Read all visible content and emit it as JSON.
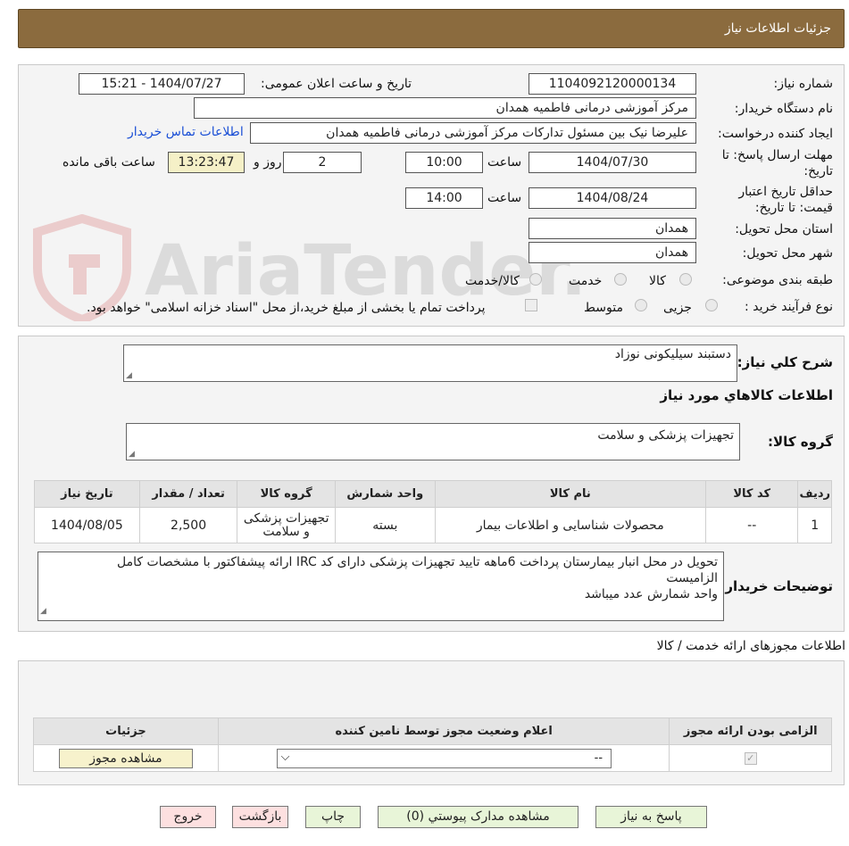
{
  "header": {
    "title": "جزئیات اطلاعات نیاز"
  },
  "watermark": {
    "text": "AriaTender.neT"
  },
  "form": {
    "need_number_label": "شماره نیاز:",
    "need_number": "1104092120000134",
    "announce_label": "تاریخ و ساعت اعلان عمومی:",
    "announce_value": "1404/07/27 - 15:21",
    "buyer_label": "نام دستگاه خریدار:",
    "buyer_value": "مرکز آموزشی درمانی فاطمیه همدان",
    "creator_label": "ایجاد کننده درخواست:",
    "creator_value": "علیرضا نیک بین مسئول تدارکات مرکز آموزشی درمانی فاطمیه همدان",
    "contact_link": "اطلاعات تماس خریدار",
    "deadline_label": "مهلت ارسال پاسخ: تا تاریخ:",
    "deadline_date": "1404/07/30",
    "time_label": "ساعت",
    "deadline_time": "10:00",
    "days_value": "2",
    "days_label": "روز و",
    "remaining_time": "13:23:47",
    "remaining_label": "ساعت باقی مانده",
    "validity_label": "حداقل تاریخ اعتبار قیمت: تا تاریخ:",
    "validity_date": "1404/08/24",
    "validity_time": "14:00",
    "province_label": "استان محل تحویل:",
    "province_value": "همدان",
    "city_label": "شهر محل تحویل:",
    "city_value": "همدان",
    "category_label": "طبقه بندی موضوعی:",
    "category_options": [
      "کالا",
      "خدمت",
      "کالا/خدمت"
    ],
    "process_label": "نوع فرآیند خرید :",
    "process_options": [
      "جزیی",
      "متوسط"
    ],
    "payment_note": "پرداخت تمام یا بخشی از مبلغ خرید،از محل \"اسناد خزانه اسلامی\" خواهد بود."
  },
  "details": {
    "summary_label": "شرح کلي نياز:",
    "summary_value": "دستبند سیلیکونی نوزاد",
    "goods_info_title": "اطلاعات کالاهاي مورد نياز",
    "goods_group_label": "گروه کالا:",
    "goods_group_value": "تجهیزات پزشکی و سلامت",
    "table": {
      "headers": [
        "رديف",
        "کد کالا",
        "نام کالا",
        "واحد شمارش",
        "گروه کالا",
        "تعداد / مقدار",
        "تاريخ نياز"
      ],
      "rows": [
        [
          "1",
          "--",
          "محصولات شناسایی و اطلاعات بیمار",
          "بسته",
          "تجهیزات پزشکی و سلامت",
          "2,500",
          "1404/08/05"
        ]
      ]
    },
    "buyer_notes_label": "توضیحات خریدار:",
    "buyer_notes_line1": "تحویل در محل انبار بیمارستان پرداخت 6ماهه تایید تجهیزات پزشکی دارای کد IRC ارائه پیشفاکتور با مشخصات کامل",
    "buyer_notes_line2": "الزامیست",
    "buyer_notes_line3": "واحد شمارش عدد میباشد"
  },
  "licenses": {
    "title": "اطلاعات مجوزهای ارائه خدمت / کالا",
    "headers": [
      "الزامی بودن ارائه مجوز",
      "اعلام وضعیت مجوز توسط نامین کننده",
      "جزئیات"
    ],
    "select_value": "--",
    "view_button": "مشاهده مجوز"
  },
  "buttons": {
    "reply": "پاسخ به نیاز",
    "attachments": "مشاهده مدارک پیوستي (0)",
    "print": "چاپ",
    "back": "بازگشت",
    "exit": "خروج"
  },
  "colors": {
    "header_bg": "#8b6b3e",
    "link": "#1a4fd6",
    "remaining_bg": "#f5f0c7"
  }
}
